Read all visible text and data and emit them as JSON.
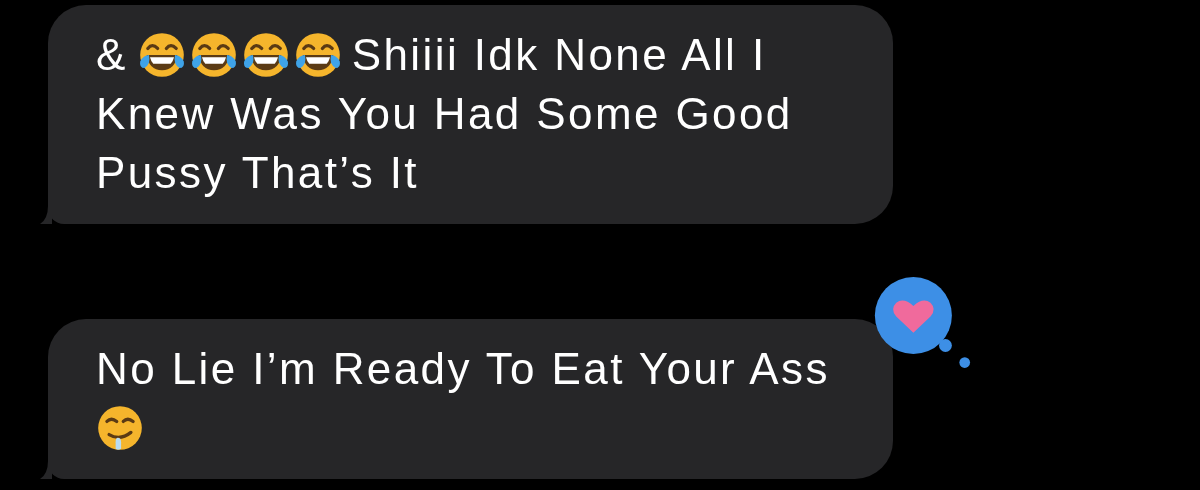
{
  "messages": [
    {
      "lines": [
        [
          {
            "kind": "text",
            "text": "&"
          },
          {
            "kind": "laugh-emoji"
          },
          {
            "kind": "laugh-emoji"
          },
          {
            "kind": "laugh-emoji"
          },
          {
            "kind": "laugh-emoji"
          },
          {
            "kind": "text",
            "text": "Shiiii Idk None All I"
          }
        ],
        [
          {
            "kind": "text",
            "text": "Knew Was You Had Some Good"
          }
        ],
        [
          {
            "kind": "text",
            "text": "Pussy That’s It"
          }
        ]
      ]
    },
    {
      "tapback": {
        "kind": "heart"
      },
      "lines": [
        [
          {
            "kind": "text",
            "text": "No Lie I’m Ready To Eat Your Ass"
          }
        ],
        [
          {
            "kind": "drool-emoji"
          }
        ]
      ]
    }
  ]
}
